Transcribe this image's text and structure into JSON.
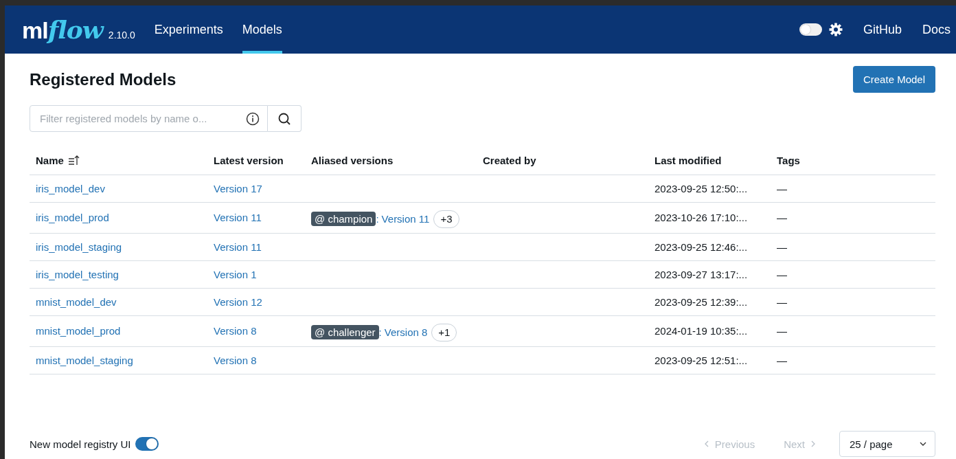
{
  "header": {
    "logo": {
      "prefix": "ml",
      "suffix": "flow"
    },
    "version": "2.10.0",
    "nav": [
      {
        "label": "Experiments",
        "selected": false
      },
      {
        "label": "Models",
        "selected": true
      }
    ],
    "theme_toggle": {
      "on": false
    },
    "links": [
      "GitHub",
      "Docs"
    ]
  },
  "page": {
    "title": "Registered Models",
    "create_button": "Create Model",
    "search": {
      "placeholder": "Filter registered models by name o..."
    }
  },
  "table": {
    "columns": [
      "Name",
      "Latest version",
      "Aliased versions",
      "Created by",
      "Last modified",
      "Tags"
    ],
    "rows": [
      {
        "name": "iris_model_dev",
        "latest": "Version 17",
        "last_modified": "2023-09-25 12:50:...",
        "tags": "—"
      },
      {
        "name": "iris_model_prod",
        "latest": "Version 11",
        "alias": {
          "label": "@ champion",
          "separator": ":",
          "version": "Version 11",
          "more": "+3"
        },
        "last_modified": "2023-10-26 17:10:...",
        "tags": "—"
      },
      {
        "name": "iris_model_staging",
        "latest": "Version 11",
        "last_modified": "2023-09-25 12:46:...",
        "tags": "—"
      },
      {
        "name": "iris_model_testing",
        "latest": "Version 1",
        "last_modified": "2023-09-27 13:17:...",
        "tags": "—"
      },
      {
        "name": "mnist_model_dev",
        "latest": "Version 12",
        "last_modified": "2023-09-25 12:39:...",
        "tags": "—"
      },
      {
        "name": "mnist_model_prod",
        "latest": "Version 8",
        "alias": {
          "label": "@ challenger",
          "separator": ":",
          "version": "Version 8",
          "more": "+1"
        },
        "last_modified": "2024-01-19 10:35:...",
        "tags": "—"
      },
      {
        "name": "mnist_model_staging",
        "latest": "Version 8",
        "last_modified": "2023-09-25 12:51:...",
        "tags": "—"
      }
    ]
  },
  "footer": {
    "registry_toggle": {
      "label": "New model registry UI",
      "on": true
    },
    "previous": {
      "label": "Previous",
      "disabled": true
    },
    "next": {
      "label": "Next",
      "disabled": true
    },
    "page_size": "25 / page"
  }
}
